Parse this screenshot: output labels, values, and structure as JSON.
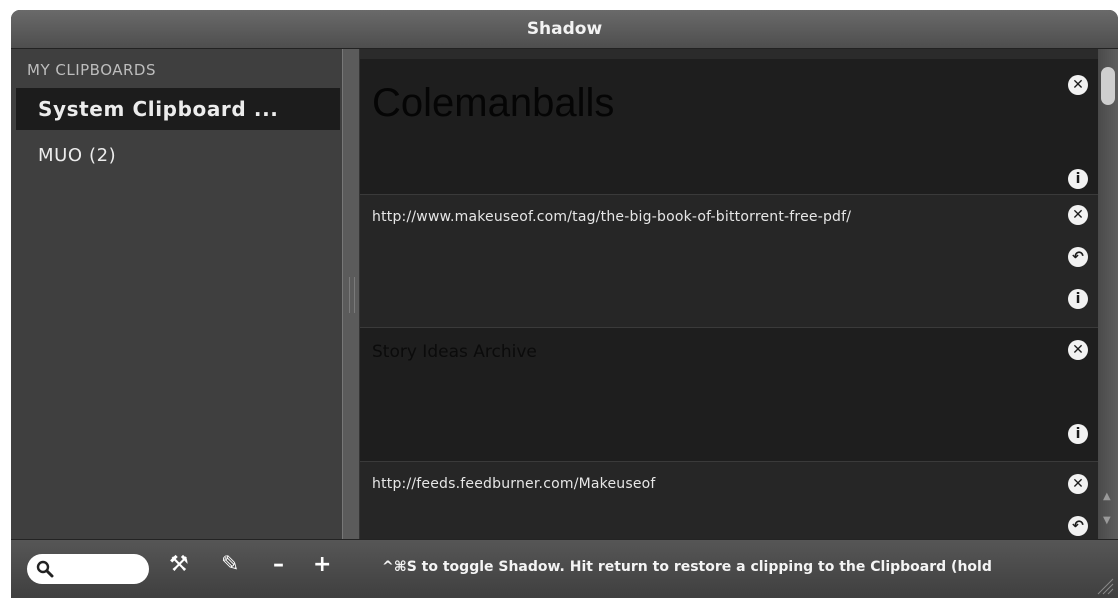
{
  "window": {
    "title": "Shadow"
  },
  "sidebar": {
    "heading": "MY CLIPBOARDS",
    "items": [
      {
        "label": "System Clipboard ...",
        "selected": true
      },
      {
        "label": "MUO (2)",
        "selected": false
      }
    ]
  },
  "clippings": [
    {
      "text": "Colemanballs",
      "actions": [
        "close-icon",
        "info-icon"
      ]
    },
    {
      "text": "http://www.makeuseof.com/tag/the-big-book-of-bittorrent-free-pdf/",
      "actions": [
        "close-icon",
        "restore-icon",
        "info-icon"
      ]
    },
    {
      "text": "Story Ideas Archive",
      "actions": [
        "close-icon",
        "info-icon"
      ]
    },
    {
      "text": "http://feeds.feedburner.com/Makeuseof",
      "actions": [
        "close-icon",
        "restore-icon"
      ]
    }
  ],
  "toolbar": {
    "search_placeholder": "",
    "icons": [
      "search-icon",
      "tools-icon",
      "pencil-icon",
      "minus-icon",
      "plus-icon"
    ],
    "minus_label": "–",
    "plus_label": "+"
  },
  "status_text": "^⌘S to toggle Shadow. Hit return to restore a clipping to the Clipboard (hold",
  "colors": {
    "selected_item_bg": "#1c1c1c",
    "sidebar_bg": "#3f3f3f",
    "content_bg": "#1e1e1e"
  }
}
